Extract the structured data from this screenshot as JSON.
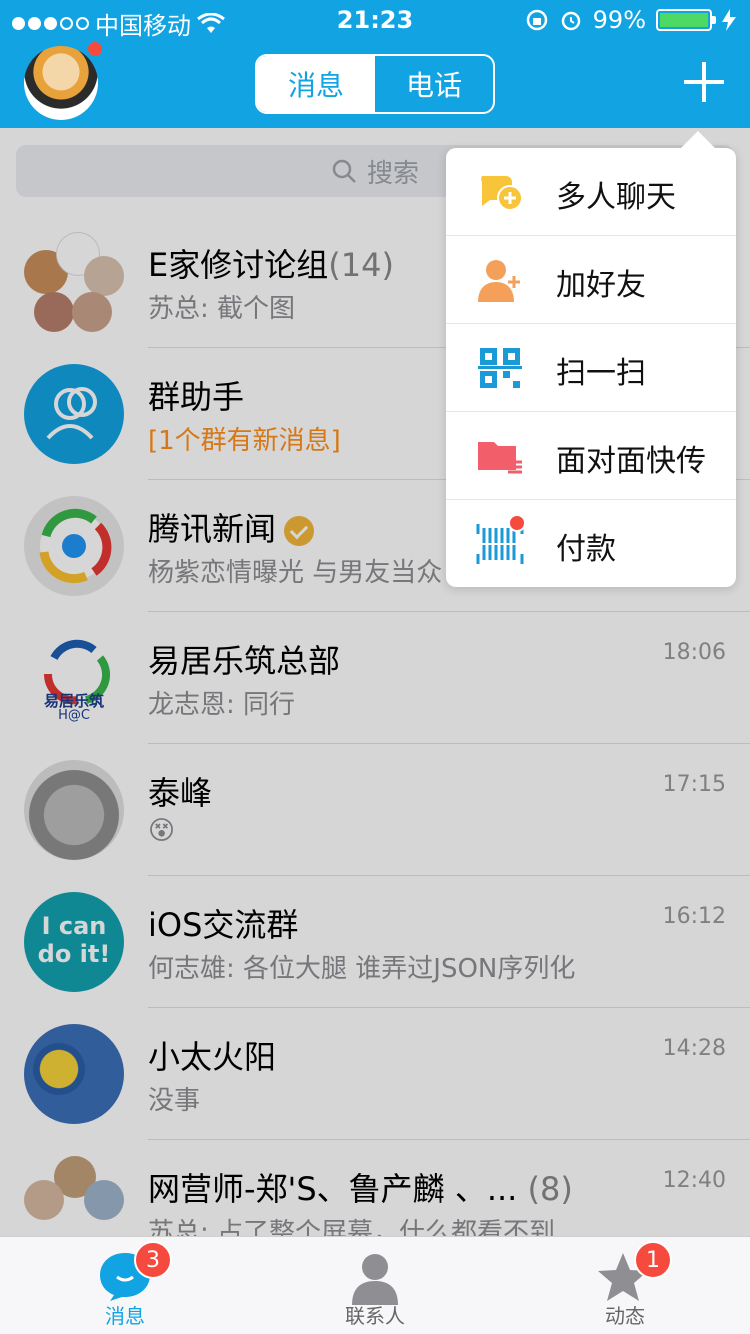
{
  "status_bar": {
    "carrier": "中国移动",
    "time": "21:23",
    "battery": "99%"
  },
  "header": {
    "tabs": [
      "消息",
      "电话"
    ],
    "active_tab": 0,
    "plus_icon": "plus-icon"
  },
  "search": {
    "placeholder": "搜索"
  },
  "conversations": [
    {
      "name": "E家修讨论组",
      "count": "(14)",
      "message": "苏总: 截个图",
      "time": ""
    },
    {
      "name": "群助手",
      "message": "[1个群有新消息]",
      "time": ""
    },
    {
      "name": "腾讯新闻",
      "message": "杨紫恋情曝光 与男友当众",
      "time": ""
    },
    {
      "name": "易居乐筑总部",
      "message": "龙志恩: 同行",
      "time": "18:06"
    },
    {
      "name": "泰峰",
      "message": "😵",
      "time": "17:15"
    },
    {
      "name": "iOS交流群",
      "message": "何志雄: 各位大腿  谁弄过JSON序列化",
      "time": "16:12"
    },
    {
      "name": "小太火阳",
      "message": "没事",
      "time": "14:28"
    },
    {
      "name": "网营师-郑'S、鲁产麟 、...",
      "count": "(8)",
      "message": "苏总: 占了整个屏幕，什么都看不到",
      "time": "12:40"
    }
  ],
  "avatar_texts": {
    "yijule": "易居乐筑",
    "hac": "H@C",
    "ican": "I can do it!"
  },
  "popup_menu": [
    {
      "label": "多人聊天",
      "icon": "group-chat-icon"
    },
    {
      "label": "加好友",
      "icon": "add-friend-icon"
    },
    {
      "label": "扫一扫",
      "icon": "qr-scan-icon"
    },
    {
      "label": "面对面快传",
      "icon": "face-to-face-icon"
    },
    {
      "label": "付款",
      "icon": "payment-barcode-icon"
    }
  ],
  "tab_bar": {
    "items": [
      {
        "label": "消息",
        "badge": "3"
      },
      {
        "label": "联系人",
        "badge": ""
      },
      {
        "label": "动态",
        "badge": "1"
      }
    ]
  },
  "colors": {
    "header_blue": "#12a3e3",
    "badge_red": "#f64a3e",
    "orange_text": "#ff8f1a",
    "verified_gold": "#f3b73a"
  }
}
